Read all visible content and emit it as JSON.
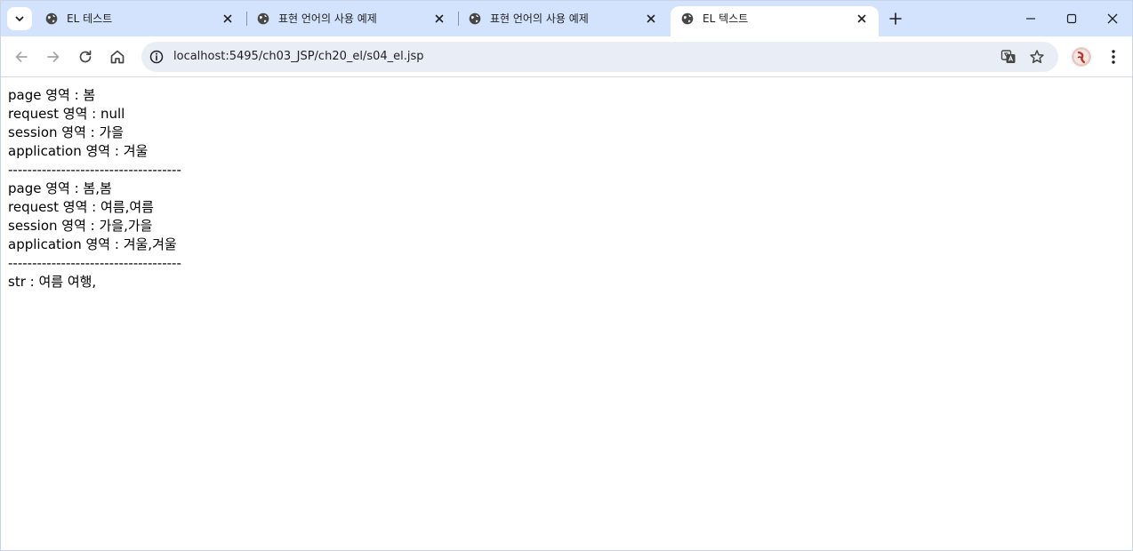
{
  "tabs": [
    {
      "title": "EL 테스트",
      "active": false
    },
    {
      "title": "표현 언어의 사용 예제",
      "active": false
    },
    {
      "title": "표현 언어의 사용 예제",
      "active": false
    },
    {
      "title": "EL 텍스트",
      "active": true
    }
  ],
  "address_bar": {
    "url": "localhost:5495/ch03_JSP/ch20_el/s04_el.jsp"
  },
  "page": {
    "lines": [
      "page 영역 : 봄",
      "request 영역 : null",
      "session 영역 : 가을",
      "application 영역 : 겨울",
      "------------------------------------",
      "page 영역 : 봄,봄",
      "request 영역 : 여름,여름",
      "session 영역 : 가을,가을",
      "application 영역 : 겨울,겨울",
      "------------------------------------",
      "str : 여름 여행,"
    ]
  },
  "colors": {
    "tabstrip_bg": "#d3e3fd",
    "omnibox_bg": "#e9eef6",
    "icon": "#474747"
  }
}
